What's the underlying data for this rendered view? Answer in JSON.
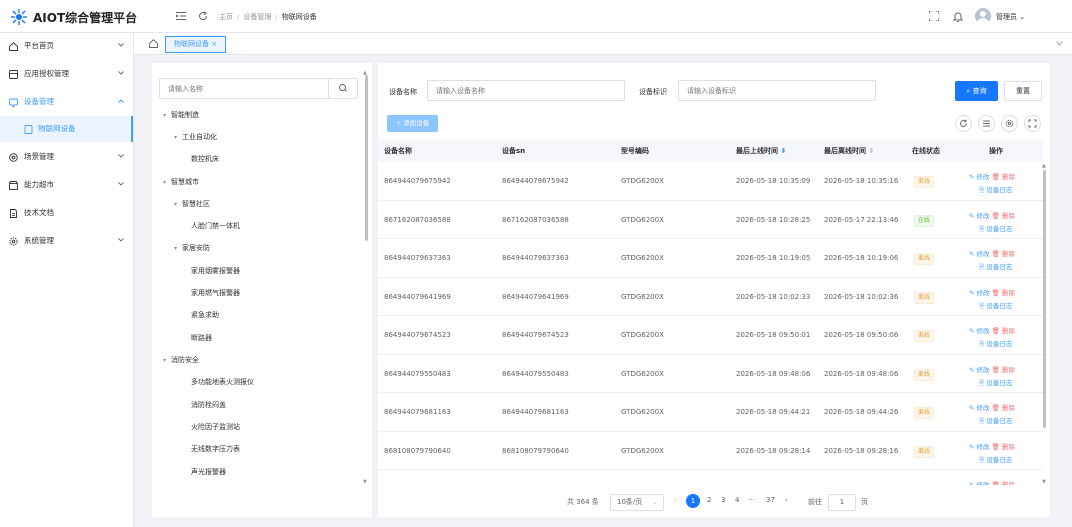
{
  "app": {
    "title": "AIOT综合管理平台",
    "user": "管理员"
  },
  "breadcrumb": [
    "主页",
    "设备管理",
    "物联网设备"
  ],
  "tabs": [
    {
      "label": "物联网设备 ×"
    }
  ],
  "sidebar": {
    "items": [
      {
        "label": "平台首页"
      },
      {
        "label": "应用授权管理"
      },
      {
        "label": "设备管理"
      },
      {
        "label": "物联网设备"
      },
      {
        "label": "场景管理"
      },
      {
        "label": "能力超市"
      },
      {
        "label": "技术文档"
      },
      {
        "label": "系统管理"
      }
    ]
  },
  "tree": {
    "search_placeholder": "请输入名称",
    "nodes": [
      {
        "label": "智能制造",
        "toggle": "▾"
      },
      {
        "label": "工业自动化",
        "toggle": "▾"
      },
      {
        "label": "数控机床"
      },
      {
        "label": "智慧城市",
        "toggle": "▾"
      },
      {
        "label": "智慧社区",
        "toggle": "▾"
      },
      {
        "label": "人脸门禁一体机"
      },
      {
        "label": "家居安防",
        "toggle": "▾"
      },
      {
        "label": "家用烟雾报警器"
      },
      {
        "label": "家用燃气报警器"
      },
      {
        "label": "紧急求助"
      },
      {
        "label": "断路器"
      },
      {
        "label": "消防安全",
        "toggle": "▾"
      },
      {
        "label": "多功能地表火测报仪"
      },
      {
        "label": "消防栓闷盖"
      },
      {
        "label": "火险因子监测站"
      },
      {
        "label": "无线数字压力表"
      },
      {
        "label": "声光报警器"
      }
    ]
  },
  "filters": {
    "name_label": "设备名称",
    "name_placeholder": "请输入设备名称",
    "id_label": "设备标识",
    "id_placeholder": "请输入设备标识",
    "search_label": "查询",
    "reset_label": "重置",
    "add_label": "+ 添加设备"
  },
  "table": {
    "columns": [
      "设备名称",
      "设备sn",
      "型号编码",
      "最后上线时间",
      "最后离线时间",
      "在线状态",
      "操作"
    ],
    "sort_marks": {
      "online": "⬍",
      "offline": "⬍"
    },
    "rows": [
      {
        "name": "864944079675942",
        "sn": "864944079675942",
        "model": "GTDG6200X",
        "on": "2026-05-18 10:35:09",
        "off": "2026-05-18 10:35:16",
        "status": "离线",
        "st": "off"
      },
      {
        "name": "867162087036588",
        "sn": "867162087036588",
        "model": "GTDG6200X",
        "on": "2026-05-18 10:28:25",
        "off": "2026-05-17 22:13:46",
        "status": "在线",
        "st": "on"
      },
      {
        "name": "864944079637363",
        "sn": "864944079637363",
        "model": "GTDG6200X",
        "on": "2026-05-18 10:19:05",
        "off": "2026-05-18 10:19:06",
        "status": "离线",
        "st": "off"
      },
      {
        "name": "864944079641969",
        "sn": "864944079641969",
        "model": "GTDG6200X",
        "on": "2026-05-18 10:02:33",
        "off": "2026-05-18 10:02:36",
        "status": "离线",
        "st": "off"
      },
      {
        "name": "864944079674523",
        "sn": "864944079674523",
        "model": "GTDG6200X",
        "on": "2026-05-18 09:50:01",
        "off": "2026-05-18 09:50:06",
        "status": "离线",
        "st": "off"
      },
      {
        "name": "864944079550483",
        "sn": "864944079550483",
        "model": "GTDG6200X",
        "on": "2026-05-18 09:48:06",
        "off": "2026-05-18 09:48:06",
        "status": "离线",
        "st": "off"
      },
      {
        "name": "864944079681163",
        "sn": "864944079681163",
        "model": "GTDG6200X",
        "on": "2026-05-18 09:44:21",
        "off": "2026-05-18 09:44:26",
        "status": "离线",
        "st": "off"
      },
      {
        "name": "868108079790640",
        "sn": "868108079790640",
        "model": "GTDG6200X",
        "on": "2026-05-18 09:28:14",
        "off": "2026-05-18 09:28:16",
        "status": "离线",
        "st": "off"
      },
      {
        "name": "",
        "sn": "",
        "model": "",
        "on": "",
        "off": "",
        "status": "",
        "st": ""
      }
    ],
    "action_edit": "修改",
    "action_delete": "删除",
    "action_log": "设备日志"
  },
  "pagination": {
    "total": "共 364 条",
    "page_size": "10条/页",
    "pages": [
      "2",
      "3",
      "4"
    ],
    "ellipsis": "···",
    "last": "37",
    "current": "1",
    "goto_label": "前往",
    "goto_value": "1",
    "page_unit": "页",
    "prev": "‹",
    "next": "›"
  }
}
